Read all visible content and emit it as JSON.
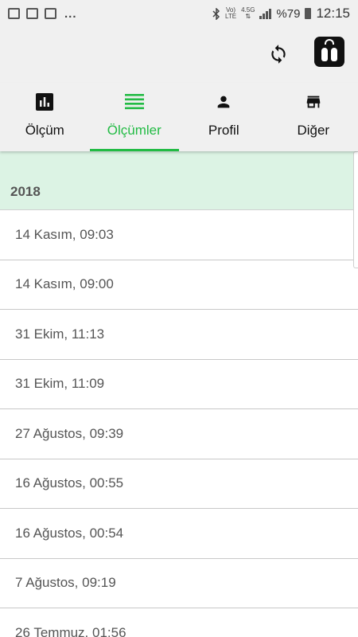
{
  "status_bar": {
    "left_icons": [
      "image-icon",
      "voicemail-icon",
      "mail-check-icon"
    ],
    "overflow": "...",
    "bluetooth": "bluetooth-icon",
    "network_top": "Vo)",
    "network_bottom": "LTE",
    "data_type": "4.5G",
    "battery_percent": "%79",
    "time": "12:15"
  },
  "app_bar": {
    "sync_icon": "sync-icon",
    "scale_icon": "scale-icon"
  },
  "tabs": [
    {
      "label": "Ölçüm",
      "icon": "bar-chart-icon",
      "active": false
    },
    {
      "label": "Ölçümler",
      "icon": "list-icon",
      "active": true
    },
    {
      "label": "Profil",
      "icon": "person-icon",
      "active": false
    },
    {
      "label": "Diğer",
      "icon": "store-icon",
      "active": false
    }
  ],
  "colors": {
    "accent": "#22bb44",
    "header_bg": "#dcf3e4",
    "toolbar_bg": "#f0f0f0"
  },
  "measurements": {
    "year": "2018",
    "items": [
      "14 Kasım, 09:03",
      "14 Kasım, 09:00",
      "31 Ekim, 11:13",
      "31 Ekim, 11:09",
      "27 Ağustos, 09:39",
      "16 Ağustos, 00:55",
      "16 Ağustos, 00:54",
      "7 Ağustos, 09:19",
      "26 Temmuz, 01:56"
    ]
  }
}
